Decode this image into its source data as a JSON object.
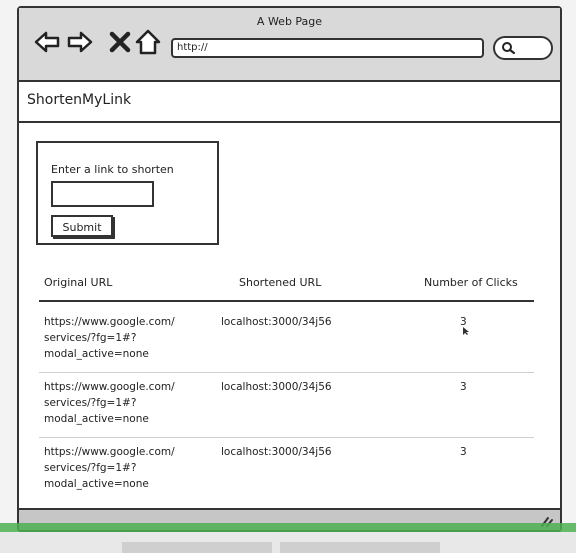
{
  "window": {
    "title": "A Web Page"
  },
  "browser": {
    "url": "http://",
    "icons": [
      "back-arrow-icon",
      "forward-arrow-icon",
      "close-icon",
      "home-icon",
      "search-icon"
    ]
  },
  "app": {
    "title": "ShortenMyLink"
  },
  "form": {
    "label": "Enter a link to shorten",
    "input_value": "",
    "submit_label": "Submit"
  },
  "table": {
    "headers": [
      "Original URL",
      "Shortened URL",
      "Number of Clicks"
    ],
    "rows": [
      {
        "original": [
          "https://www.google.com/",
          "services/?fg=1#?",
          "modal_active=none"
        ],
        "short": "localhost:3000/34j56",
        "clicks": "3"
      },
      {
        "original": [
          "https://www.google.com/",
          "services/?fg=1#?",
          "modal_active=none"
        ],
        "short": "localhost:3000/34j56",
        "clicks": "3"
      },
      {
        "original": [
          "https://www.google.com/",
          "services/?fg=1#?",
          "modal_active=none"
        ],
        "short": "localhost:3000/34j56",
        "clicks": "3"
      }
    ]
  },
  "colors": {
    "chrome": "#d9d9d9",
    "border": "#333333",
    "accent_line": "#4caf50"
  }
}
